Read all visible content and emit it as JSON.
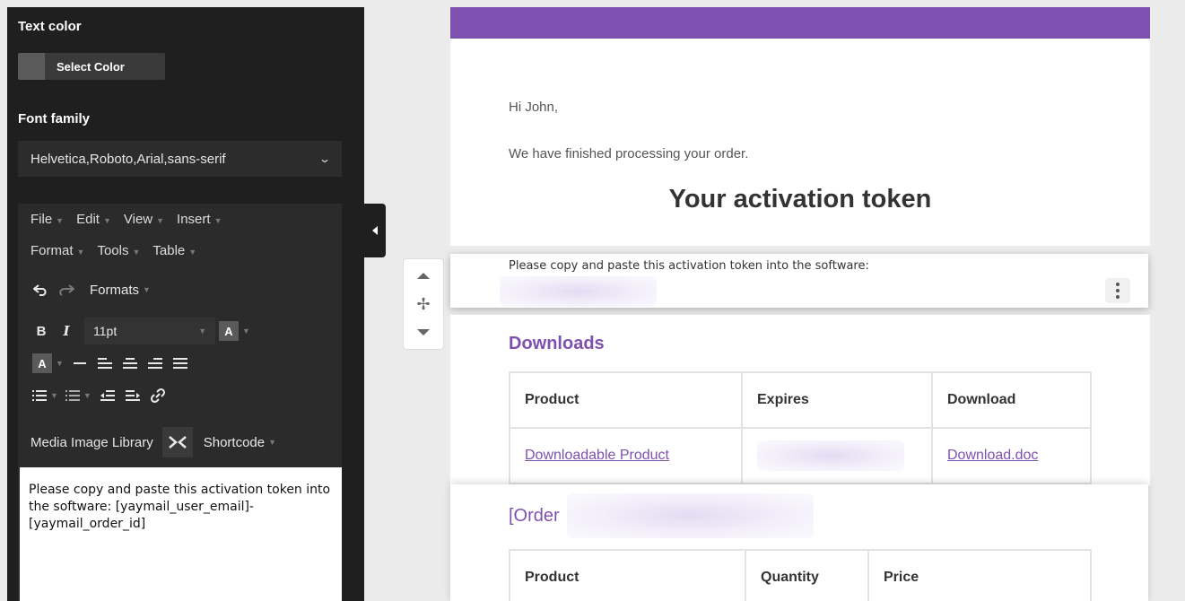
{
  "sidebar": {
    "text_color_title": "Text color",
    "select_color_label": "Select Color",
    "font_family_title": "Font family",
    "font_family_value": "Helvetica,Roboto,Arial,sans-serif",
    "menus": [
      "File",
      "Edit",
      "View",
      "Insert",
      "Format",
      "Tools",
      "Table"
    ],
    "formats_label": "Formats",
    "font_size": "11pt",
    "media_label": "Media Image Library",
    "shortcode_label": "Shortcode",
    "editor_content": "Please copy and paste this activation token into the software: [yaymail_user_email]-[yaymail_order_id]"
  },
  "email": {
    "greeting": "Hi John,",
    "message": "We have finished processing your order.",
    "heading": "Your activation token",
    "token_instruction": "Please copy and paste this activation token into the software:",
    "downloads_title": "Downloads",
    "downloads_headers": [
      "Product",
      "Expires",
      "Download"
    ],
    "downloads_row": {
      "product": "Downloadable Product",
      "download": "Download.doc"
    },
    "order_title": "[Order",
    "order_headers": [
      "Product",
      "Quantity",
      "Price"
    ]
  },
  "colors": {
    "accent": "#7e51b0",
    "sidebar_bg": "#1f1f1f"
  },
  "icons": [
    "undo-icon",
    "redo-icon",
    "bold-icon",
    "italic-icon",
    "text-color-icon",
    "bg-color-icon",
    "horizontal-rule-icon",
    "align-left-icon",
    "align-center-icon",
    "align-right-icon",
    "justify-icon",
    "bullet-list-icon",
    "numbered-list-icon",
    "outdent-icon",
    "indent-icon",
    "link-icon",
    "fullscreen-icon",
    "move-icon",
    "kebab-icon"
  ]
}
